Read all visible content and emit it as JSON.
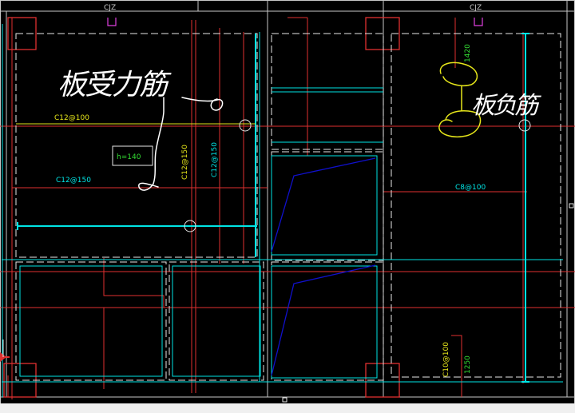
{
  "canvas": {
    "background": "#000000",
    "frame": "#c8c8c8"
  },
  "colors": {
    "beam": "#e03030",
    "slab": "#00e5e5",
    "dash": "#e8e8e8",
    "grid": "#c8c8c8",
    "yellow": "#e6e61a",
    "green": "#33dd33",
    "brace": "#1010cc",
    "magenta": "#e040e0",
    "handwriting": "#ffffff",
    "handwriting_yellow": "#e6e61a"
  },
  "labels": {
    "cjz_left": "CJZ",
    "cjz_right": "CJZ",
    "rebar_c12_100": "C12@100",
    "rebar_c12_150_horiz": "C12@150",
    "rebar_c12_150_vert_a": "C12@150",
    "rebar_c12_150_vert_b": "C12@150",
    "rebar_c8_100": "C8@100",
    "rebar_c10_100": "C10@100",
    "dim_1420": "1420",
    "dim_1250": "1250",
    "slab_thickness": "h=140"
  },
  "annotations": {
    "handwritten_left": "板受力筋",
    "handwritten_right": "板负筋"
  },
  "icons": {
    "column_marker": "column-square-icon",
    "circle_marker": "rebar-circle-icon",
    "ucs_marker": "ucs-axis-icon"
  }
}
